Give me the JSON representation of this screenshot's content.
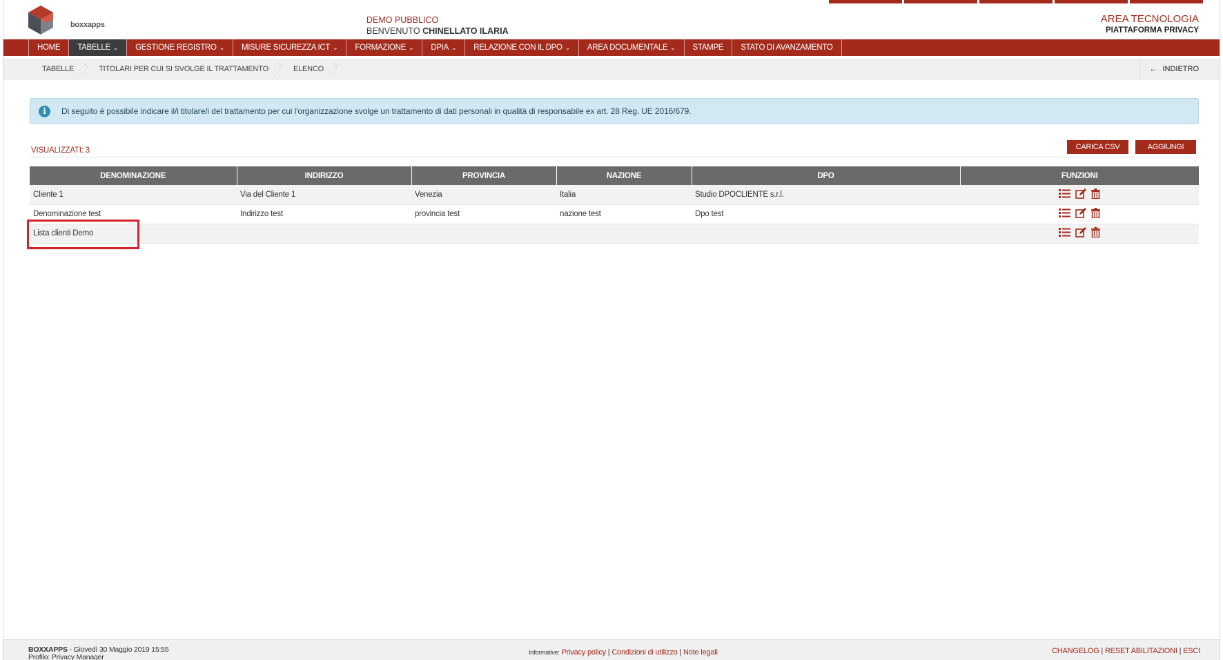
{
  "header": {
    "org": "DEMO PUBBLICO",
    "welcome_prefix": "BENVENUTO",
    "user": "CHINELLATO ILARIA",
    "area": "AREA TECNOLOGIA",
    "platform": "PIATTAFORMA PRIVACY",
    "logo_text": "boxxapps"
  },
  "nav": [
    {
      "label": "HOME"
    },
    {
      "label": "TABELLE",
      "dropdown": true,
      "active": true
    },
    {
      "label": "GESTIONE REGISTRO",
      "dropdown": true
    },
    {
      "label": "MISURE SICUREZZA ICT",
      "dropdown": true
    },
    {
      "label": "FORMAZIONE",
      "dropdown": true
    },
    {
      "label": "DPIA",
      "dropdown": true
    },
    {
      "label": "RELAZIONE CON IL DPO",
      "dropdown": true
    },
    {
      "label": "AREA DOCUMENTALE",
      "dropdown": true
    },
    {
      "label": "STAMPE"
    },
    {
      "label": "STATO DI AVANZAMENTO"
    }
  ],
  "breadcrumb": [
    "TABELLE",
    "TITOLARI PER CUI SI SVOLGE IL TRATTAMENTO",
    "ELENCO"
  ],
  "back_label": "INDIETRO",
  "alert": "Di seguito è possibile indicare il/i titolare/i del trattamento per cui l'organizzazione svolge un trattamento di dati personali in qualità di responsabile ex art. 28 Reg. UE 2016/679.",
  "count_label": "VISUALIZZATI: 3",
  "buttons": {
    "csv": "CARICA CSV",
    "add": "AGGIUNGI"
  },
  "table": {
    "columns": [
      "DENOMINAZIONE",
      "INDIRIZZO",
      "PROVINCIA",
      "NAZIONE",
      "DPO",
      "FUNZIONI"
    ],
    "rows": [
      [
        "Cliente 1",
        "Via del Cliente 1",
        "Venezia",
        "Italia",
        "Studio DPOCLIENTE s.r.l."
      ],
      [
        "Denominazione test",
        "Indirizzo test",
        "provincia test",
        "nazione test",
        "Dpo test"
      ],
      [
        "Lista clienti Demo",
        "",
        "",
        "",
        ""
      ]
    ]
  },
  "footer": {
    "brand": "BOXXAPPS",
    "date": " - Giovedì 30 Maggio 2019 15:55",
    "profile": "Profilo: Privacy Manager",
    "info_label": "Informative:",
    "privacy": "Privacy policy",
    "conditions": "Condizioni di utilizzo",
    "legal": "Note legali",
    "changelog": "CHANGELOG",
    "reset": "RESET ABILITAZIONI",
    "exit": "ESCI"
  },
  "colors": {
    "brand": "#a42b1c",
    "nav_active": "#3c3c3c",
    "table_header": "#6a6a6a",
    "alert_bg": "#d2e8f2",
    "highlight": "#d4222a"
  },
  "icons": [
    "info-icon",
    "list-icon",
    "edit-icon",
    "trash-icon",
    "back-arrow-icon"
  ]
}
